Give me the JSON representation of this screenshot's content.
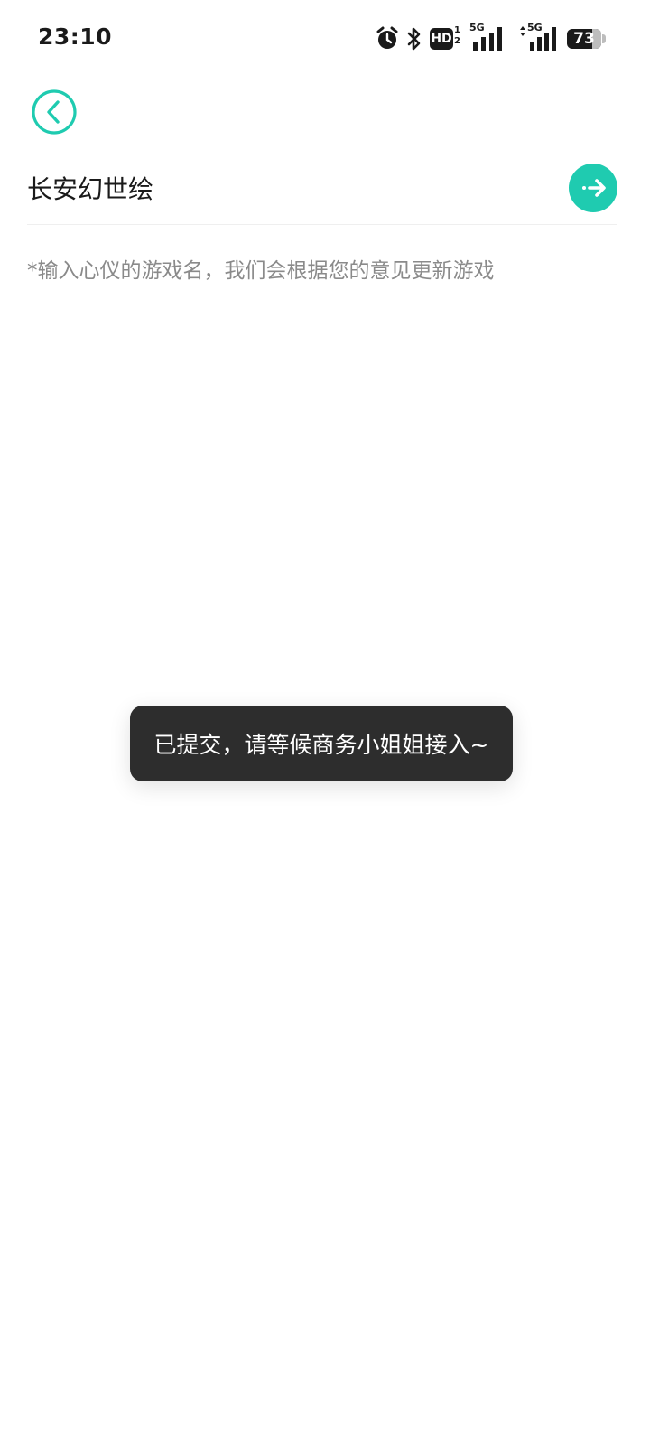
{
  "status_bar": {
    "time": "23:10",
    "icons": [
      "alarm-icon",
      "bluetooth-icon",
      "hd-volte-icon",
      "signal-5g-icon",
      "signal-5g-data-icon",
      "battery-icon"
    ],
    "hd_label": "HD",
    "hd_sub": "1 2",
    "net1_label": "5G",
    "net2_label": "5G",
    "battery_level": "73",
    "battery_fraction": 0.73
  },
  "header": {
    "back_icon": "chevron-left-icon"
  },
  "input": {
    "value": "长安幻世绘",
    "submit_icon": "arrow-right-icon",
    "accent_color": "#1fcbb0"
  },
  "hint": "*输入心仪的游戏名，我们会根据您的意见更新游戏",
  "toast": {
    "message": "已提交，请等候商务小姐姐接入~"
  }
}
